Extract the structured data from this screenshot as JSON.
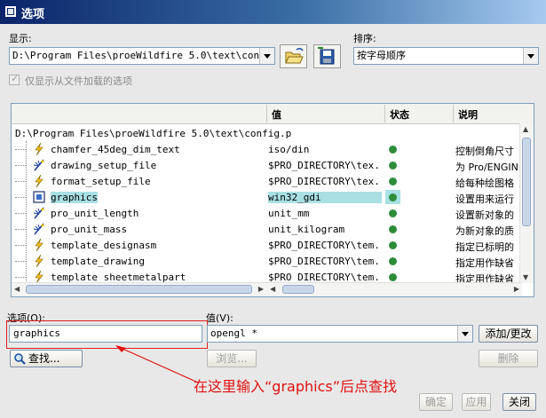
{
  "window": {
    "title": "选项"
  },
  "display": {
    "label": "显示:",
    "value": "D:\\Program Files\\proeWildfire 5.0\\text\\config.p"
  },
  "sort": {
    "label": "排序:",
    "value": "按字母顺序"
  },
  "filter_checkbox": {
    "label": "仅显示从文件加载的选项",
    "checked": true
  },
  "table": {
    "headers": {
      "value": "值",
      "status": "状态",
      "desc": "说明"
    },
    "root_path": "D:\\Program Files\\proeWildfire 5.0\\text\\config.p",
    "rows": [
      {
        "name": "chamfer_45deg_dim_text",
        "value": "iso/din",
        "desc": "控制倒角尺寸",
        "icon": "lightning-icon"
      },
      {
        "name": "drawing_setup_file",
        "value": "$PRO_DIRECTORY\\tex...",
        "desc": "为 Pro/ENGIN",
        "icon": "star-icon"
      },
      {
        "name": "format_setup_file",
        "value": "$PRO_DIRECTORY\\tex...",
        "desc": "给每种绘图格",
        "icon": "lightning-icon"
      },
      {
        "name": "graphics",
        "value": "win32_gdi",
        "desc": "设置用来运行",
        "icon": "screen-icon"
      },
      {
        "name": "pro_unit_length",
        "value": "unit_mm",
        "desc": "设置新对象的",
        "icon": "star-icon"
      },
      {
        "name": "pro_unit_mass",
        "value": "unit_kilogram",
        "desc": "为新对象的质",
        "icon": "star-icon"
      },
      {
        "name": "template_designasm",
        "value": "$PRO_DIRECTORY\\tem...",
        "desc": "指定已标明的",
        "icon": "lightning-icon"
      },
      {
        "name": "template_drawing",
        "value": "$PRO_DIRECTORY\\tem...",
        "desc": "指定用作缺省",
        "icon": "lightning-icon"
      },
      {
        "name": "template_sheetmetalpart",
        "value": "$PRO_DIRECTORY\\tem...",
        "desc": "指定用作缺省",
        "icon": "lightning-icon"
      }
    ],
    "status_color": "#2e8b3a",
    "selected_row_color": "#a8e0e4"
  },
  "option": {
    "label": "选项(O):",
    "value": "graphics"
  },
  "value": {
    "label": "值(V):",
    "value": "opengl *"
  },
  "buttons": {
    "find": "查找...",
    "add_change": "添加/更改",
    "browse": "浏览...",
    "delete": "删除",
    "ok": "确定",
    "apply": "应用",
    "close": "关闭"
  },
  "annotation": {
    "text": "在这里输入“graphics”后点查找",
    "color": "#e01010"
  }
}
